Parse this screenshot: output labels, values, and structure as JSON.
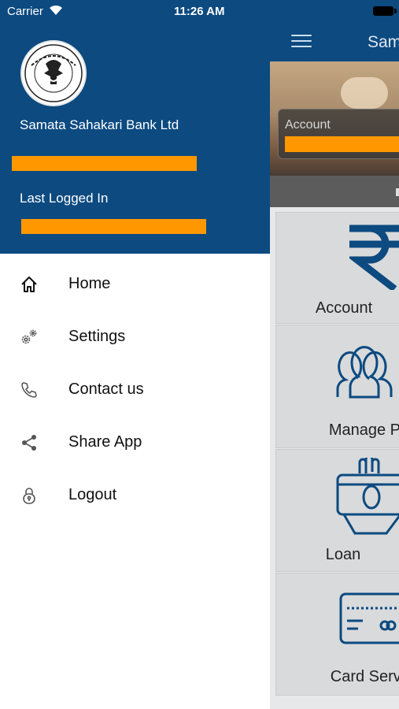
{
  "status": {
    "carrier": "Carrier",
    "time": "11:26 AM"
  },
  "drawer": {
    "bank_name": "Samata Sahakari Bank Ltd",
    "last_logged_label": "Last Logged In",
    "menu": [
      {
        "label": "Home",
        "icon": "home-icon"
      },
      {
        "label": "Settings",
        "icon": "gears-icon"
      },
      {
        "label": "Contact us",
        "icon": "phone-icon"
      },
      {
        "label": "Share App",
        "icon": "share-icon"
      },
      {
        "label": "Logout",
        "icon": "lock-icon"
      }
    ]
  },
  "main": {
    "title": "Sam",
    "account_label": "Account",
    "tiles": [
      {
        "label": "Account",
        "icon": "rupee-icon"
      },
      {
        "label": "Manage Pa",
        "icon": "people-icon"
      },
      {
        "label": "Loan",
        "icon": "loan-hand-icon"
      },
      {
        "label": "Card Servi",
        "icon": "card-icon"
      }
    ]
  },
  "colors": {
    "primary": "#0c4a80",
    "mask": "#ff9800",
    "icon_blue": "#0c4a80"
  }
}
